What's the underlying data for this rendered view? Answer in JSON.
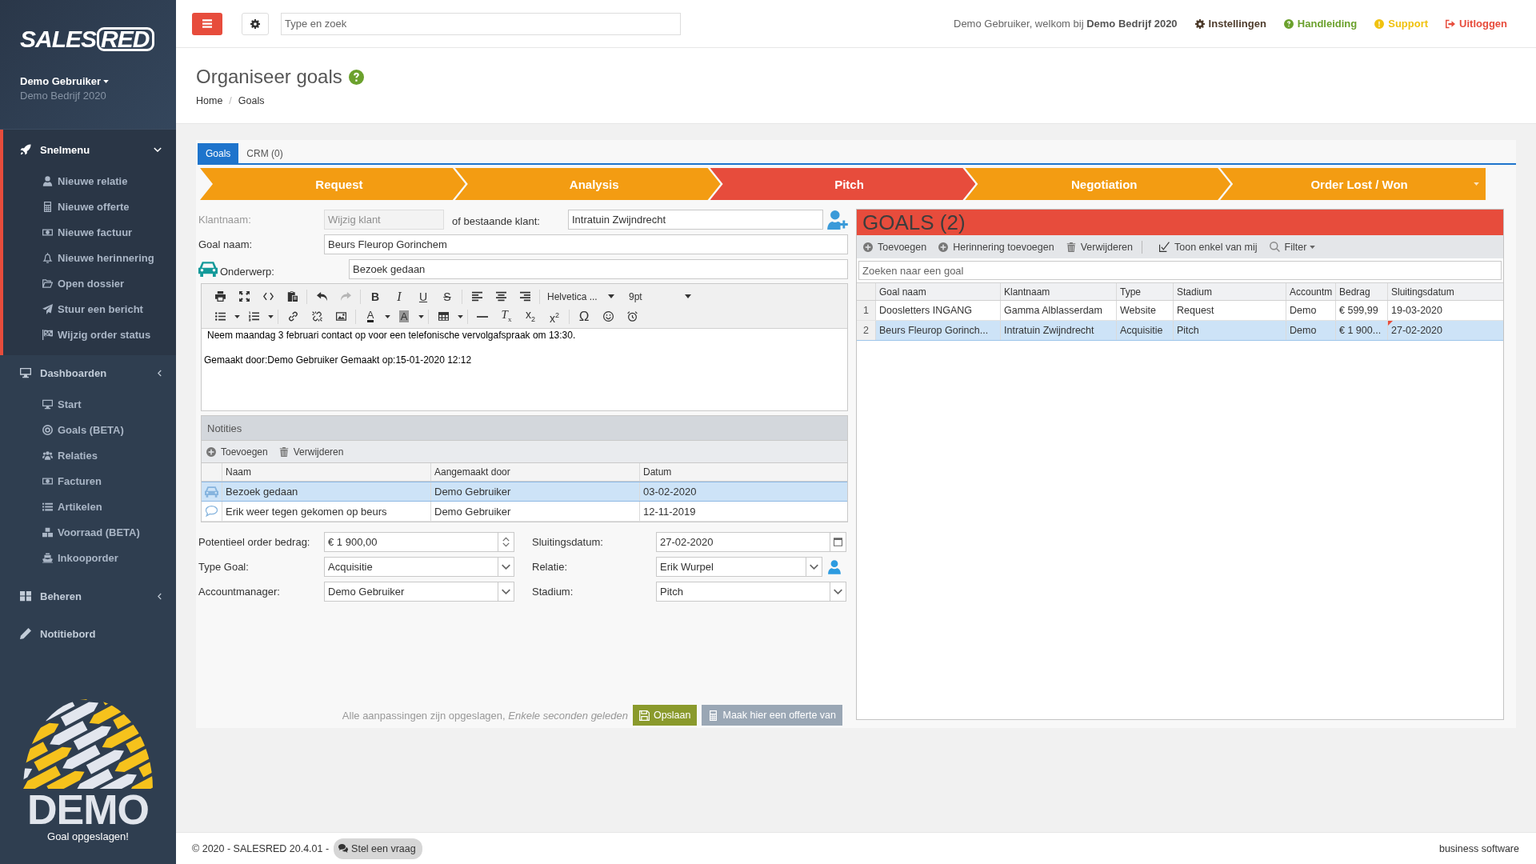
{
  "sidebar": {
    "logo": {
      "part_1": "SALES",
      "part_2": "RED"
    },
    "user": {
      "name": "Demo Gebruiker",
      "company": "Demo Bedrijf 2020"
    },
    "sections": [
      {
        "label": "Snelmenu",
        "kind": "group",
        "active": true,
        "items": [
          "Nieuwe relatie",
          "Nieuwe offerte",
          "Nieuwe factuur",
          "Nieuwe herinnering",
          "Open dossier",
          "Stuur een bericht",
          "Wijzig order status"
        ]
      },
      {
        "label": "Dashboarden",
        "kind": "group",
        "active": false,
        "items": [
          "Start",
          "Goals (BETA)",
          "Relaties",
          "Facturen",
          "Artikelen",
          "Voorraad (BETA)",
          "Inkooporder"
        ]
      },
      {
        "label": "Beheren",
        "kind": "group",
        "active": false
      },
      {
        "label": "Notitiebord",
        "kind": "link",
        "active": false
      }
    ],
    "demo_logo": "DEMO",
    "toast": "Goal opgeslagen!"
  },
  "topbar": {
    "search": {
      "placeholder": "Type en zoek"
    },
    "welcome": "Demo Gebruiker, welkom bij **Demo Bedrijf 2020**",
    "links": [
      {
        "label": "Instellingen",
        "color": "#4e3c2c"
      },
      {
        "label": "Handleiding",
        "color": "#6ba12d"
      },
      {
        "label": "Support",
        "color": "#f0c20f"
      },
      {
        "label": "Uitloggen",
        "color": "#e74c3c"
      }
    ]
  },
  "page": {
    "title": "Organiseer goals",
    "breadcrumb": [
      "Home",
      "Goals"
    ],
    "breadcrumb_separator": "/"
  },
  "tabs": [
    {
      "label": "Goals",
      "selected": true
    },
    {
      "label": "CRM (0)",
      "selected": false
    }
  ],
  "stages": [
    {
      "label": "Request",
      "selected": false,
      "has_menu": false
    },
    {
      "label": "Analysis",
      "selected": false,
      "has_menu": false
    },
    {
      "label": "Pitch",
      "selected": true,
      "has_menu": false
    },
    {
      "label": "Negotiation",
      "selected": false,
      "has_menu": false
    },
    {
      "label": "Order Lost / Won",
      "selected": false,
      "has_menu": true
    }
  ],
  "goal_form": {
    "customer": {
      "label": "Klantnaam:",
      "placeholder": "Wijzig klant",
      "disabled": true,
      "alt_label": "of bestaande klant:",
      "value": "Intratuin Zwijndrecht"
    },
    "goal_name": {
      "label": "Goal naam:",
      "value": "Beurs Fleurop Gorinchem"
    },
    "subject": {
      "label": "Onderwerp:",
      "value": "Bezoek gedaan"
    },
    "editor": {
      "redo_disabled": true,
      "glyphs": [
        "B",
        "I",
        "U",
        "S",
        "A",
        "A",
        "*T*$_{x}$",
        "x$_{2}$",
        "x$^{2}$",
        "Ω"
      ],
      "font_family": "Helvetica ...",
      "font_size": "9pt",
      "lines": [
        "Neem maandag 3 februari contact op voor een telefonische vervolgafspraak om 13:30.",
        "Gemaakt door:Demo Gebruiker Gemaakt op:15-01-2020 12:12"
      ]
    },
    "notes": {
      "title": "Notities",
      "actions": [
        "Toevoegen",
        "Verwijderen"
      ],
      "columns": [
        "Naam",
        "Aangemaakt door",
        "Datum"
      ],
      "rows": [
        {
          "kind": "visit",
          "selected": true,
          "cells": [
            "Bezoek gedaan",
            "Demo Gebruiker",
            "03-02-2020"
          ]
        },
        {
          "kind": "comment",
          "selected": false,
          "cells": [
            "Erik weer tegen gekomen op beurs",
            "Demo Gebruiker",
            "12-11-2019"
          ]
        }
      ]
    },
    "fields": [
      {
        "label": "Potentieel order bedrag:",
        "kind": "number",
        "value": "€ 1 900,00"
      },
      {
        "label": "Sluitingsdatum:",
        "kind": "date",
        "value": "27-02-2020"
      },
      {
        "label": "Type Goal:",
        "kind": "select",
        "value": "Acquisitie"
      },
      {
        "label": "Relatie:",
        "kind": "contact",
        "value": "Erik Wurpel"
      },
      {
        "label": "Accountmanager:",
        "kind": "select",
        "value": "Demo Gebruiker"
      },
      {
        "label": "Stadium:",
        "kind": "select",
        "value": "Pitch"
      }
    ],
    "save_status": "Alle aanpassingen zijn opgeslagen, *Enkele seconden geleden*",
    "buttons": [
      {
        "label": "Opslaan",
        "kind": "primary"
      },
      {
        "label": "Maak hier een offerte van",
        "kind": "secondary"
      }
    ]
  },
  "goals_panel": {
    "title": "GOALS (2)",
    "actions": [
      {
        "label": "Toevoegen",
        "kind": "add"
      },
      {
        "label": "Herinnering toevoegen",
        "kind": "add"
      },
      {
        "label": "Verwijderen",
        "kind": "delete"
      },
      {
        "label": "Toon enkel van mij",
        "kind": "checkbox",
        "checked": true
      },
      {
        "label": "Filter",
        "kind": "filter"
      }
    ],
    "search": {
      "placeholder": "Zoeken naar een goal"
    },
    "columns": [
      "Goal naam",
      "Klantnaam",
      "Type",
      "Stadium",
      "Accountm",
      "Bedrag",
      "Sluitingsdatum"
    ],
    "rows": [
      {
        "number": "1",
        "selected": false,
        "edited": false,
        "cells": [
          "Doosletters INGANG",
          "Gamma Alblasserdam",
          "Website",
          "Request",
          "Demo",
          "€ 599,99",
          "19-03-2020"
        ]
      },
      {
        "number": "2",
        "selected": true,
        "edited": true,
        "cells": [
          "Beurs Fleurop Gorinch...",
          "Intratuin Zwijndrecht",
          "Acquisitie",
          "Pitch",
          "Demo",
          "€ 1 900...",
          "27-02-2020"
        ]
      }
    ]
  },
  "footer": {
    "copyright": "© 2020 - SALESRED 20.4.01 -",
    "help_button": "Stel een vraag",
    "tagline": "business software"
  }
}
